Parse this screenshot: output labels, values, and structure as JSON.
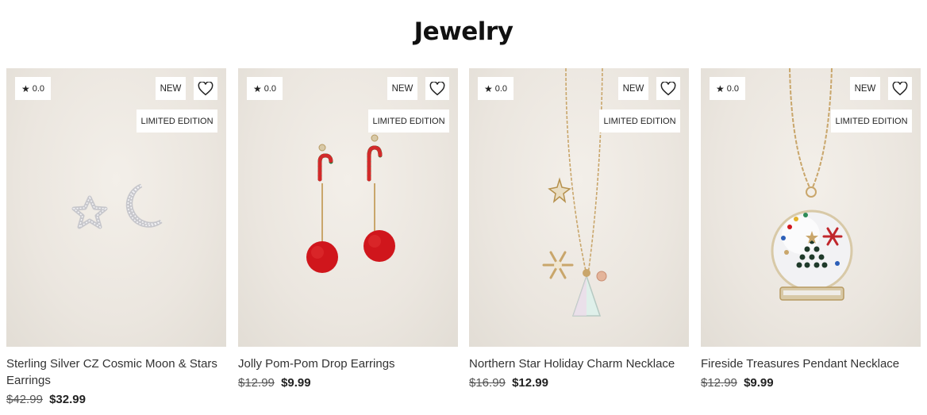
{
  "page": {
    "title": "Jewelry"
  },
  "products": [
    {
      "name": "Sterling Silver CZ Cosmic Moon & Stars Earrings",
      "rating": "0.0",
      "new_badge": "NEW",
      "limited_badge": "LIMITED EDITION",
      "old_price": "$42.99",
      "price": "$32.99"
    },
    {
      "name": "Jolly Pom-Pom Drop Earrings",
      "rating": "0.0",
      "new_badge": "NEW",
      "limited_badge": "LIMITED EDITION",
      "old_price": "$12.99",
      "price": "$9.99"
    },
    {
      "name": "Northern Star Holiday Charm Necklace",
      "rating": "0.0",
      "new_badge": "NEW",
      "limited_badge": "LIMITED EDITION",
      "old_price": "$16.99",
      "price": "$12.99"
    },
    {
      "name": "Fireside Treasures Pendant Necklace",
      "rating": "0.0",
      "new_badge": "NEW",
      "limited_badge": "LIMITED EDITION",
      "old_price": "$12.99",
      "price": "$9.99"
    }
  ],
  "icons": {
    "rating": "star-icon",
    "wishlist": "heart-icon"
  },
  "colors": {
    "image_bg": "#ebe6df",
    "pom_pom": "#d0161c",
    "gold": "#c9a66b"
  }
}
